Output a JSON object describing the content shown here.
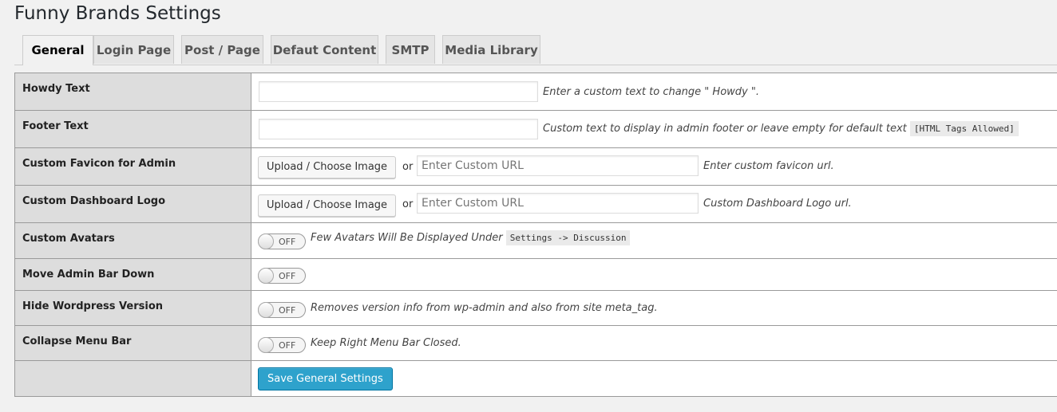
{
  "page": {
    "title": "Funny Brands Settings"
  },
  "tabs": [
    {
      "label": "General",
      "active": true
    },
    {
      "label": "Login Page",
      "active": false
    },
    {
      "label": "Post / Page",
      "active": false
    },
    {
      "label": "Defaut Content",
      "active": false
    },
    {
      "label": "SMTP",
      "active": false
    },
    {
      "label": "Media Library",
      "active": false
    }
  ],
  "rows": {
    "howdy": {
      "label": "Howdy Text",
      "value": "",
      "desc": "Enter a custom text to change \" Howdy \"."
    },
    "footer": {
      "label": "Footer Text",
      "value": "",
      "desc": "Custom text to display in admin footer or leave empty for default text",
      "code": "[HTML Tags Allowed]"
    },
    "favicon": {
      "label": "Custom Favicon for Admin",
      "upload_label": "Upload / Choose Image",
      "or": "or",
      "placeholder": "Enter Custom URL",
      "desc": "Enter custom favicon url."
    },
    "logo": {
      "label": "Custom Dashboard Logo",
      "upload_label": "Upload / Choose Image",
      "or": "or",
      "placeholder": "Enter Custom URL",
      "desc": "Custom Dashboard Logo url."
    },
    "avatars": {
      "label": "Custom Avatars",
      "state": "OFF",
      "desc": "Few Avatars Will Be Displayed Under",
      "code": "Settings -> Discussion"
    },
    "adminbar": {
      "label": "Move Admin Bar Down",
      "state": "OFF"
    },
    "wpversion": {
      "label": "Hide Wordpress Version",
      "state": "OFF",
      "desc": "Removes version info from wp-admin and also from site meta_tag."
    },
    "collapse": {
      "label": "Collapse Menu Bar",
      "state": "OFF",
      "desc": "Keep Right Menu Bar Closed."
    }
  },
  "save_button": {
    "label": "Save General Settings"
  },
  "colors": {
    "primary": "#2ea2cc",
    "label_bg": "#dddddd",
    "page_bg": "#f1f1f1"
  }
}
